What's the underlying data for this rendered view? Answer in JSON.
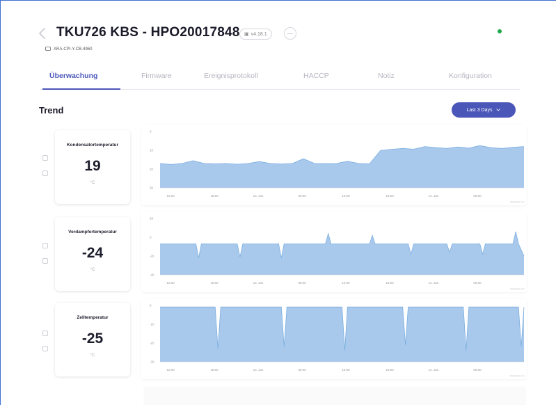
{
  "header": {
    "title": "TKU726 KBS - HPO20017848",
    "version": "v4.18.1",
    "more_label": "···",
    "subtitle": "ARA-CPI-Y-CB-4960",
    "status_color": "#1ea84a"
  },
  "tabs": [
    {
      "label": "Überwachung",
      "active": true
    },
    {
      "label": "Firmware",
      "active": false
    },
    {
      "label": "Ereignisprotokoll",
      "active": false
    },
    {
      "label": "HACCP",
      "active": false
    },
    {
      "label": "Notiz",
      "active": false
    },
    {
      "label": "Konfiguration",
      "active": false
    }
  ],
  "trend": {
    "title": "Trend",
    "range_label": "Last 3 Days",
    "range_icon": "chevron-down-icon"
  },
  "cards": [
    {
      "label": "Kondensatortemperatur",
      "value": "19",
      "unit": "°C"
    },
    {
      "label": "Verdampfertemperatur",
      "value": "-24",
      "unit": "°C"
    },
    {
      "label": "Zelltemperatur",
      "value": "-25",
      "unit": "°C"
    }
  ],
  "chart_data": [
    {
      "type": "area",
      "series": [
        {
          "name": "Kondensatortemperatur",
          "color": "#a9c9ec"
        }
      ],
      "x_ticks": [
        "12:00",
        "18:00",
        "13. Jan",
        "06:00",
        "12:00",
        "18:00",
        "14. Jan",
        "06:00"
      ],
      "y_ticks": [
        "0",
        "10",
        "20",
        "30"
      ],
      "ylim": [
        0,
        30
      ],
      "x": [
        0,
        2,
        4,
        6,
        8,
        10,
        12,
        14,
        16,
        18,
        20,
        22,
        24,
        26,
        28,
        30,
        32,
        34,
        36,
        38,
        40,
        42,
        44,
        46,
        48,
        50,
        52,
        54,
        56,
        58,
        60,
        62,
        64,
        66
      ],
      "y": [
        13,
        12.5,
        13,
        14.5,
        13,
        12.8,
        13,
        12.6,
        13,
        14,
        13,
        12.7,
        13,
        15.5,
        13,
        12.9,
        13,
        14.2,
        13,
        12.8,
        20,
        20.5,
        21,
        20.6,
        22,
        21.5,
        21,
        21.8,
        21.2,
        22.5,
        21.4,
        21,
        21.6,
        22
      ],
      "credit": "Highcharts.com"
    },
    {
      "type": "area",
      "series": [
        {
          "name": "Verdampfertemperatur",
          "color": "#a9c9ec"
        }
      ],
      "x_ticks": [
        "12:00",
        "18:00",
        "13. Jan",
        "06:00",
        "12:00",
        "18:00",
        "14. Jan",
        "06:00"
      ],
      "y_ticks": [
        "20",
        "0",
        "-20",
        "-40"
      ],
      "ylim": [
        -40,
        20
      ],
      "x": [
        0,
        6.5,
        7,
        7.5,
        14,
        14.5,
        15,
        21.5,
        22,
        22.5,
        30,
        30.5,
        31,
        38,
        38.5,
        39,
        45,
        45.5,
        46,
        52,
        52.5,
        53,
        58,
        58.5,
        59,
        64,
        64.5,
        65,
        66
      ],
      "y": [
        -7,
        -7,
        -22,
        -7,
        -7,
        -21,
        -7,
        -7,
        -22,
        -7,
        -7,
        4,
        -7,
        -7,
        2,
        -7,
        -7,
        -18,
        -7,
        -7,
        -16,
        -7,
        -7,
        -18,
        -7,
        -7,
        6,
        -7,
        -20
      ],
      "credit": "Highcharts.com"
    },
    {
      "type": "area",
      "series": [
        {
          "name": "Zelltemperatur",
          "color": "#a9c9ec"
        }
      ],
      "x_ticks": [
        "12:00",
        "18:00",
        "13. Jan",
        "06:00",
        "12:00",
        "18:00",
        "14. Jan",
        "06:00"
      ],
      "y_ticks": [
        "0",
        "-10",
        "-20",
        "-30"
      ],
      "ylim": [
        -30,
        0
      ],
      "x": [
        0,
        10,
        10.5,
        11,
        22,
        22.5,
        23,
        33,
        33.5,
        34,
        44,
        44.5,
        45,
        55,
        55.5,
        56,
        65,
        65.5,
        66
      ],
      "y": [
        -0.8,
        -0.8,
        -23,
        -0.8,
        -0.8,
        -22,
        -0.8,
        -0.8,
        -24,
        -0.8,
        -0.8,
        -21,
        -0.8,
        -0.8,
        -24,
        -0.8,
        -0.8,
        -22,
        -0.8
      ],
      "credit": "Highcharts.com"
    }
  ]
}
